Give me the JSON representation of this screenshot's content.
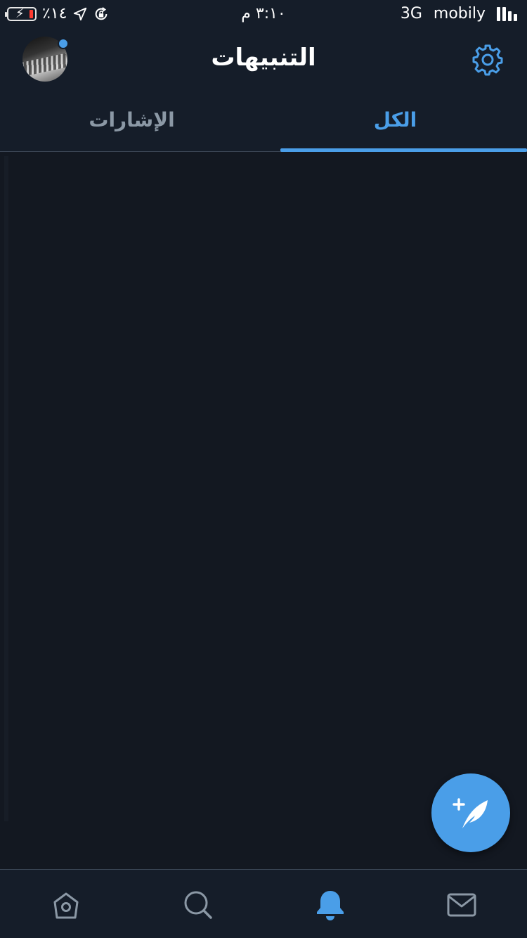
{
  "status_bar": {
    "battery_text": "٪١٤",
    "time": "٣:١٠ م",
    "network": "3G",
    "carrier": "mobily",
    "icons": [
      "battery-charging-icon",
      "location-arrow-icon",
      "rotation-lock-icon",
      "signal-bars-icon"
    ]
  },
  "header": {
    "title": "التنبيهات",
    "avatar_icon": "profile-avatar",
    "settings_icon": "gear-icon"
  },
  "tabs": [
    {
      "label": "الكل",
      "active": true
    },
    {
      "label": "الإشارات",
      "active": false
    }
  ],
  "fab": {
    "icon": "compose-tweet-icon"
  },
  "tab_bar": {
    "items": [
      {
        "icon": "home-icon",
        "active": false
      },
      {
        "icon": "search-icon",
        "active": false
      },
      {
        "icon": "bell-icon",
        "active": true
      },
      {
        "icon": "mail-icon",
        "active": false
      }
    ]
  },
  "colors": {
    "accent": "#4a9ee8",
    "background": "#131821",
    "bar_background": "#151d29",
    "inactive_text": "#8b98a5",
    "icon_inactive": "#8b98a5"
  }
}
